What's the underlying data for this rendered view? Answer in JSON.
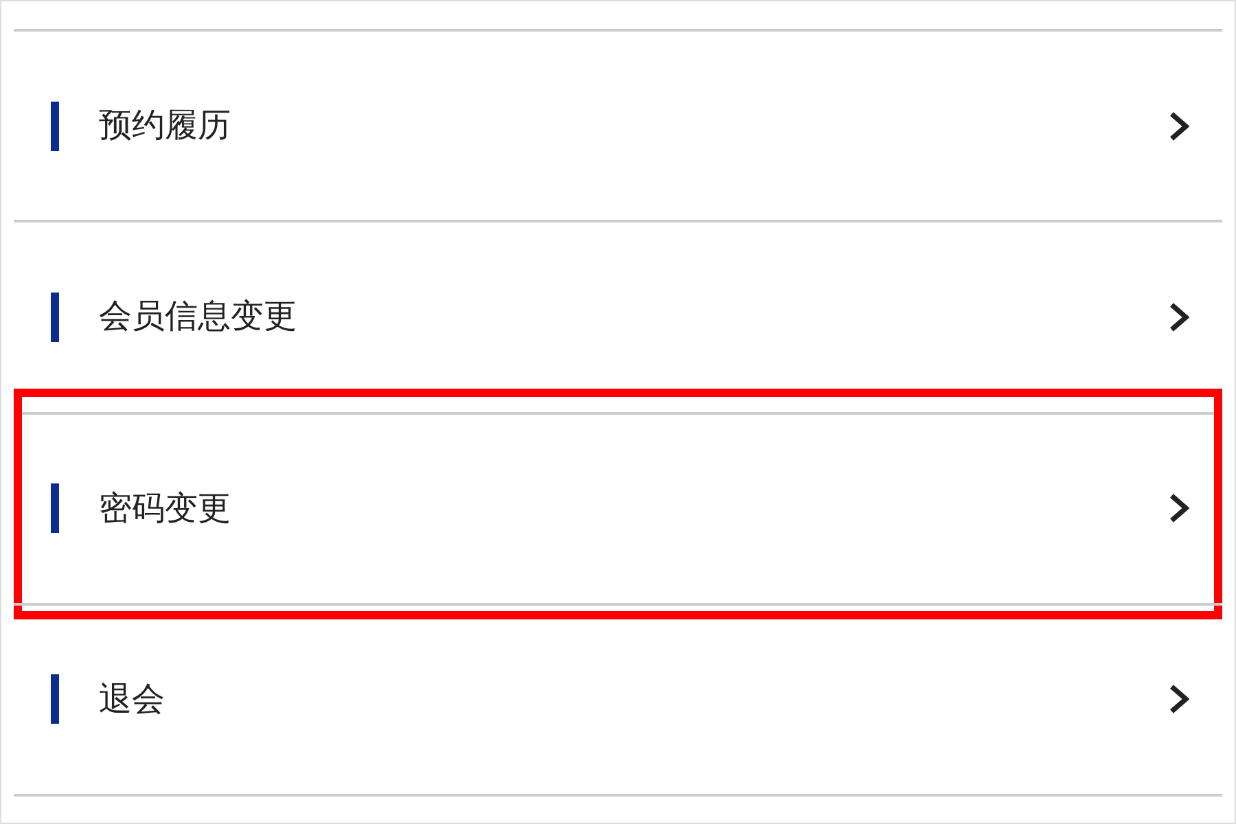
{
  "menu": {
    "items": [
      {
        "label": "预约履历",
        "highlighted": false
      },
      {
        "label": "会员信息变更",
        "highlighted": false
      },
      {
        "label": "密码变更",
        "highlighted": true
      },
      {
        "label": "退会",
        "highlighted": false
      }
    ]
  }
}
